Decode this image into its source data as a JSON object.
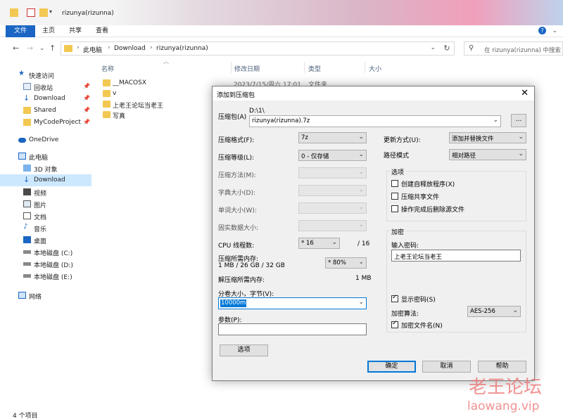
{
  "window": {
    "title": "rizunya(rizunna)"
  },
  "ribbon": {
    "tabs": [
      "文件",
      "主页",
      "共享",
      "查看"
    ]
  },
  "address": {
    "crumbs": [
      "此电脑",
      "Download",
      "rizunya(rizunna)"
    ]
  },
  "search": {
    "placeholder": "在 rizunya(rizunna) 中搜索"
  },
  "sidebar": {
    "items": [
      {
        "label": "快速访问",
        "icon": "star-icon"
      },
      {
        "label": "回收站",
        "icon": "recycle-bin-icon"
      },
      {
        "label": "Download",
        "icon": "download-icon"
      },
      {
        "label": "Shared",
        "icon": "folder-icon"
      },
      {
        "label": "MyCodeProject",
        "icon": "folder-icon"
      },
      {
        "label": "OneDrive",
        "icon": "cloud-icon"
      },
      {
        "label": "此电脑",
        "icon": "computer-icon"
      },
      {
        "label": "3D 对象",
        "icon": "cube-icon"
      },
      {
        "label": "Download",
        "icon": "download-icon"
      },
      {
        "label": "视频",
        "icon": "video-icon"
      },
      {
        "label": "图片",
        "icon": "picture-icon"
      },
      {
        "label": "文档",
        "icon": "document-icon"
      },
      {
        "label": "音乐",
        "icon": "music-icon"
      },
      {
        "label": "桌面",
        "icon": "desktop-icon"
      },
      {
        "label": "本地磁盘 (C:)",
        "icon": "drive-icon"
      },
      {
        "label": "本地磁盘 (D:)",
        "icon": "drive-icon"
      },
      {
        "label": "本地磁盘 (E:)",
        "icon": "drive-icon"
      },
      {
        "label": "网络",
        "icon": "network-icon"
      }
    ]
  },
  "filelist": {
    "columns": [
      "名称",
      "修改日期",
      "类型",
      "大小"
    ],
    "rows": [
      {
        "name": "__MACOSX",
        "date": "2023/7/15/周六 17:01",
        "type": "文件夹"
      },
      {
        "name": "v",
        "date": "",
        "type": ""
      },
      {
        "name": "上老王论坛当老王",
        "date": "",
        "type": ""
      },
      {
        "name": "写真",
        "date": "",
        "type": ""
      }
    ]
  },
  "status": {
    "count": "4 个项目"
  },
  "watermark": {
    "line1": "老王论坛",
    "line2": "laowang.vip"
  },
  "dialog": {
    "title": "添加到压缩包",
    "archive_label": "压缩包(A)",
    "archive_path": "D:\\1\\",
    "archive_name": "rizunya(rizunna).7z",
    "browse": "...",
    "format_label": "压缩格式(F):",
    "format_value": "7z",
    "level_label": "压缩等级(L):",
    "level_value": "0 - 仅存储",
    "method_label": "压缩方法(M):",
    "dict_label": "字典大小(D):",
    "word_label": "单词大小(W):",
    "solid_label": "固实数据大小:",
    "threads_label": "CPU 线程数:",
    "threads_value": "* 16",
    "threads_total": "/ 16",
    "mem_comp_label": "压缩所需内存:",
    "mem_comp_value": "1 MB / 26 GB / 32 GB",
    "mem_comp_pct": "* 80%",
    "mem_decomp_label": "解压缩所需内存:",
    "mem_decomp_value": "1 MB",
    "volume_label": "分卷大小，字节(V):",
    "volume_value": "10000m",
    "params_label": "参数(P):",
    "params_value": "",
    "options_button": "选项",
    "update_label": "更新方式(U):",
    "update_value": "添加并替换文件",
    "path_label": "路径模式",
    "path_value": "相对路径",
    "options_group": "选项",
    "opt_sfx": "创建自释放程序(X)",
    "opt_shared": "压缩共享文件",
    "opt_delete": "操作完成后删除源文件",
    "encrypt_group": "加密",
    "password_label": "输入密码:",
    "password_value": "上老王论坛当老王",
    "show_password": "显示密码(S)",
    "enc_method_label": "加密算法:",
    "enc_method_value": "AES-256",
    "encrypt_names": "加密文件名(N)",
    "ok": "确定",
    "cancel": "取消",
    "help": "帮助"
  }
}
